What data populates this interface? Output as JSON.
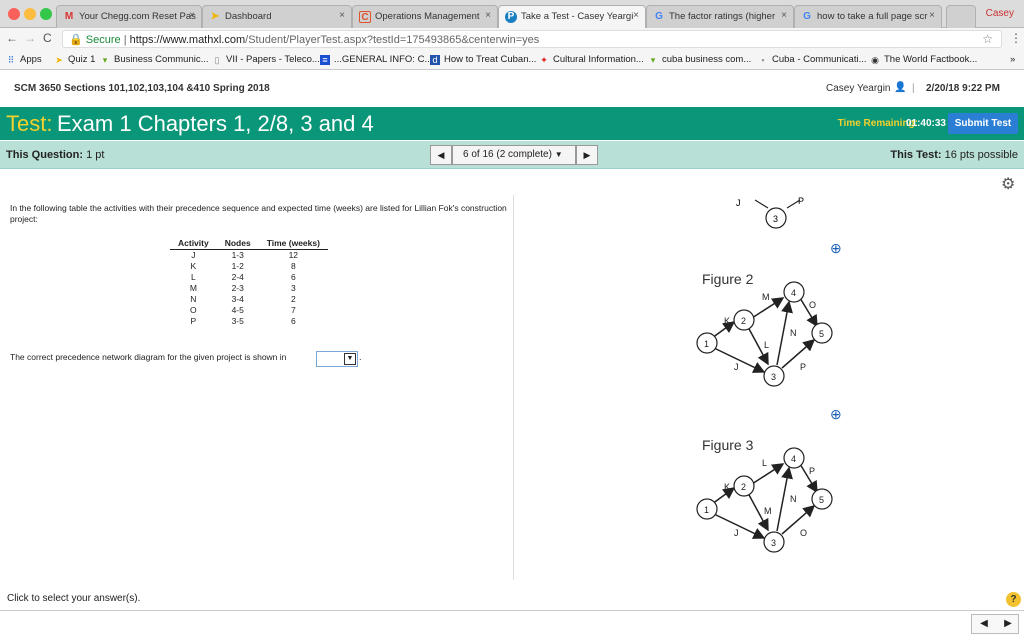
{
  "browser": {
    "tabs": [
      {
        "title": "Your Chegg.com Reset Pas",
        "favicon": "gmail-icon"
      },
      {
        "title": "Dashboard",
        "favicon": "arrow-icon"
      },
      {
        "title": "Operations Management",
        "favicon": "c-icon"
      },
      {
        "title": "Take a Test - Casey Yeargi",
        "favicon": "p-icon"
      },
      {
        "title": "The factor ratings (higher",
        "favicon": "google-icon"
      },
      {
        "title": "how to take a full page scr",
        "favicon": "google-icon"
      }
    ],
    "profile": "Casey",
    "url_secure": "Secure",
    "url_host": "https://www.mathxl.com",
    "url_path": "/Student/PlayerTest.aspx?testId=175493865&centerwin=yes",
    "bookmarks": [
      "Apps",
      "Quiz 1",
      "Business Communic...",
      "VII - Papers - Teleco...",
      "...GENERAL INFO: C...",
      "How to Treat Cuban...",
      "Cultural Information...",
      "cuba business com...",
      "Cuba - Communicati...",
      "The World Factbook..."
    ]
  },
  "course": {
    "name": "SCM 3650 Sections 101,102,103,104 &410 Spring 2018",
    "user": "Casey Yeargin",
    "datetime": "2/20/18 9:22 PM"
  },
  "test": {
    "label": "Test:",
    "title": "Exam 1 Chapters 1, 2/8, 3 and 4",
    "time_label": "Time Remaining:",
    "time_value": "01:40:33",
    "submit": "Submit Test"
  },
  "info": {
    "question_label": "This Question:",
    "question_pts": "1 pt",
    "position": "6 of 16 (2 complete)",
    "test_label": "This Test:",
    "test_pts": "16 pts possible"
  },
  "question": {
    "intro": "In the following table the activities with their precedence sequence and expected time (weeks) are listed for Lillian Fok's construction project:",
    "headers": [
      "Activity",
      "Nodes",
      "Time (weeks)"
    ],
    "rows": [
      [
        "J",
        "1-3",
        "12"
      ],
      [
        "K",
        "1-2",
        "8"
      ],
      [
        "L",
        "2-4",
        "6"
      ],
      [
        "M",
        "2-3",
        "3"
      ],
      [
        "N",
        "3-4",
        "2"
      ],
      [
        "O",
        "4-5",
        "7"
      ],
      [
        "P",
        "3-5",
        "6"
      ]
    ],
    "answer_prompt": "The correct precedence network diagram for the given project is shown in",
    "answer_suffix": "."
  },
  "figures": [
    {
      "title": "Figure 2"
    },
    {
      "title": "Figure 3"
    }
  ],
  "footer": {
    "message": "Click to select your answer(s).",
    "help": "?"
  }
}
